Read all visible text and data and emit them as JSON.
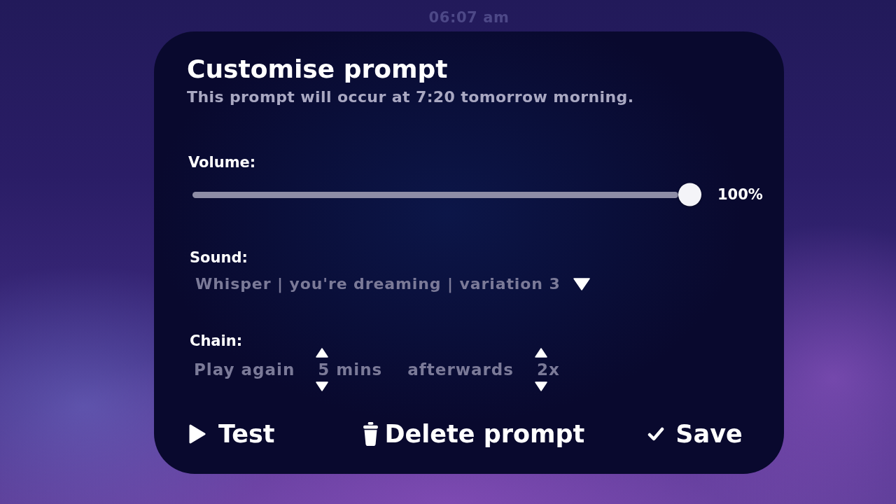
{
  "clock": {
    "time": "06:07 am"
  },
  "dialog": {
    "title": "Customise prompt",
    "subtitle": "This prompt will occur at 7:20 tomorrow morning."
  },
  "volume": {
    "label": "Volume:",
    "level": 1,
    "reading": "100%"
  },
  "sound": {
    "label": "Sound:",
    "value": "Whisper | you're dreaming | variation 3"
  },
  "chain": {
    "label": "Chain:",
    "items": [
      {
        "kind": "text",
        "text": "Play again"
      },
      {
        "kind": "stepper",
        "value": "5 mins"
      },
      {
        "kind": "text",
        "text": "afterwards"
      },
      {
        "kind": "stepper",
        "value": "2x"
      }
    ]
  },
  "actions": [
    {
      "kind": "play",
      "label": "Test"
    },
    {
      "kind": "trash",
      "label": "Delete prompt"
    },
    {
      "kind": "check",
      "label": "Save"
    }
  ]
}
